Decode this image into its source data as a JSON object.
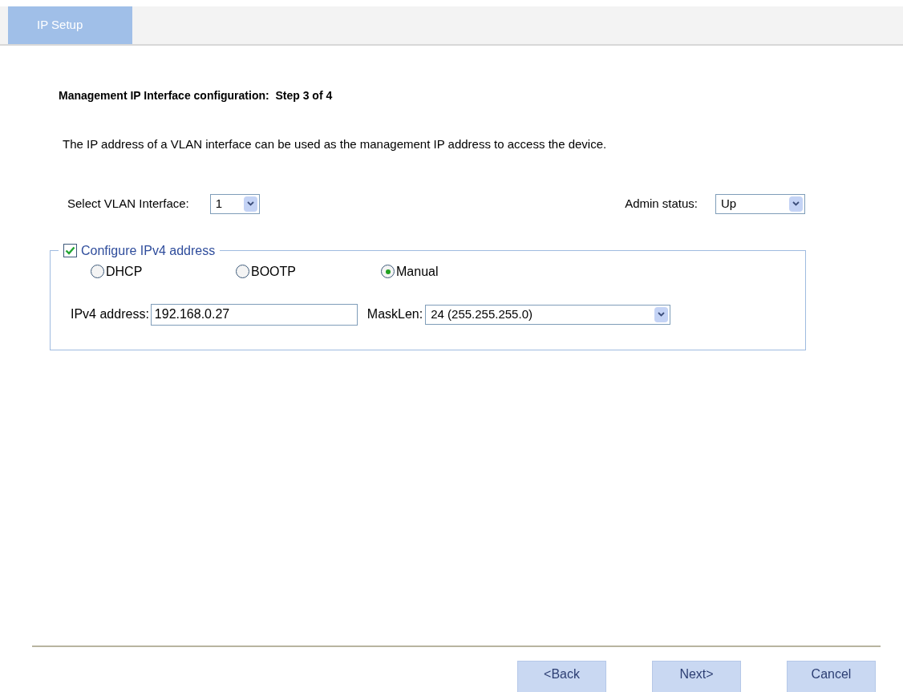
{
  "tabs": [
    {
      "label": "IP Setup",
      "selected": true
    }
  ],
  "heading": "Management IP Interface configuration:  Step 3 of 4",
  "description": "The IP address of a VLAN interface can be used as the management IP address to access the device.",
  "vlan_select": {
    "label": "Select VLAN Interface:",
    "value": "1"
  },
  "admin_status": {
    "label": "Admin status:",
    "value": "Up"
  },
  "ipv4_group": {
    "label": "Configure IPv4 address",
    "checked": true,
    "modes": [
      {
        "label": "DHCP",
        "selected": false
      },
      {
        "label": "BOOTP",
        "selected": false
      },
      {
        "label": "Manual",
        "selected": true
      }
    ],
    "address": {
      "label": "IPv4 address:",
      "value": "192.168.0.27"
    },
    "masklen": {
      "label": "MaskLen:",
      "value": "24 (255.255.255.0)"
    }
  },
  "buttons": [
    "<Back",
    "Next>",
    "Cancel"
  ]
}
